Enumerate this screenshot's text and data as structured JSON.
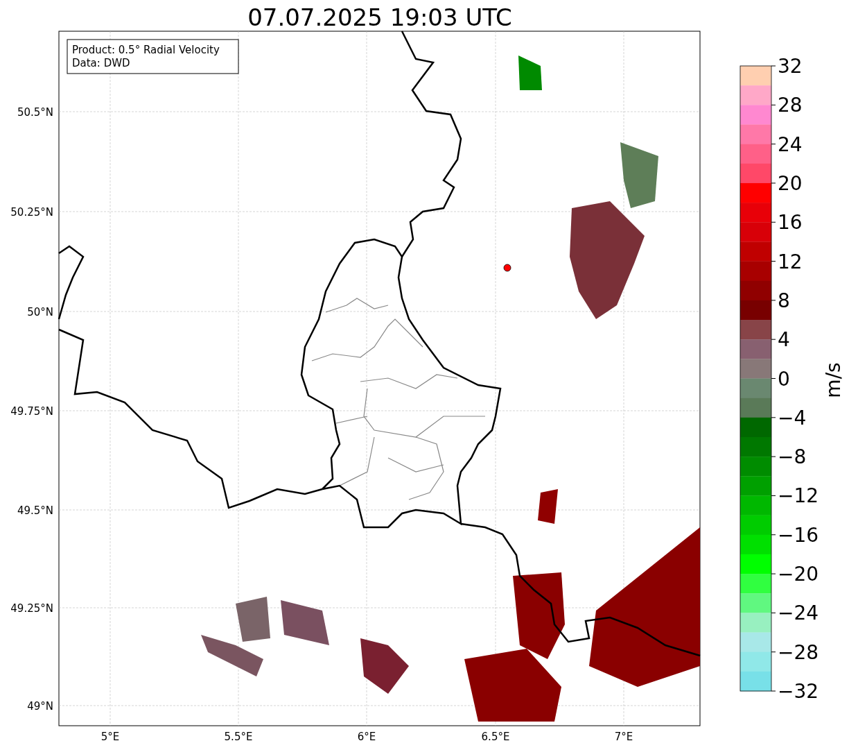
{
  "title": "07.07.2025 19:03 UTC",
  "legend": [
    "Product: 0.5° Radial Velocity",
    "Data: DWD"
  ],
  "y_axis_labels": [
    "50.5°N",
    "50.25°N",
    "50°N",
    "49.75°N",
    "49.5°N",
    "49.25°N",
    "49°N"
  ],
  "x_axis_labels": [
    "5°E",
    "5.5°E",
    "6°E",
    "6.5°E",
    "7°E"
  ],
  "colorbar": {
    "label": "m/s",
    "ticks": [
      "32",
      "28",
      "24",
      "20",
      "16",
      "12",
      "8",
      "4",
      "0",
      "−4",
      "−8",
      "−12",
      "−16",
      "−20",
      "−24",
      "−28",
      "−32"
    ],
    "bands": [
      {
        "color": "#ffcfb0"
      },
      {
        "color": "#ffa8c8"
      },
      {
        "color": "#ff88d0"
      },
      {
        "color": "#ff78a8"
      },
      {
        "color": "#ff6088"
      },
      {
        "color": "#ff4868"
      },
      {
        "color": "#ff0000"
      },
      {
        "color": "#e80008"
      },
      {
        "color": "#d80008"
      },
      {
        "color": "#c00000"
      },
      {
        "color": "#a80000"
      },
      {
        "color": "#900000"
      },
      {
        "color": "#780000"
      },
      {
        "color": "#884448"
      },
      {
        "color": "#886070"
      },
      {
        "color": "#887878"
      },
      {
        "color": "#6a8870"
      },
      {
        "color": "#5a7a58"
      },
      {
        "color": "#006800"
      },
      {
        "color": "#007800"
      },
      {
        "color": "#008c00"
      },
      {
        "color": "#00a000"
      },
      {
        "color": "#00b800"
      },
      {
        "color": "#00cc00"
      },
      {
        "color": "#00e000"
      },
      {
        "color": "#00ff00"
      },
      {
        "color": "#30ff40"
      },
      {
        "color": "#60f880"
      },
      {
        "color": "#98f0c0"
      },
      {
        "color": "#a8e8e8"
      },
      {
        "color": "#90e8e8"
      },
      {
        "color": "#78e0e8"
      }
    ]
  }
}
